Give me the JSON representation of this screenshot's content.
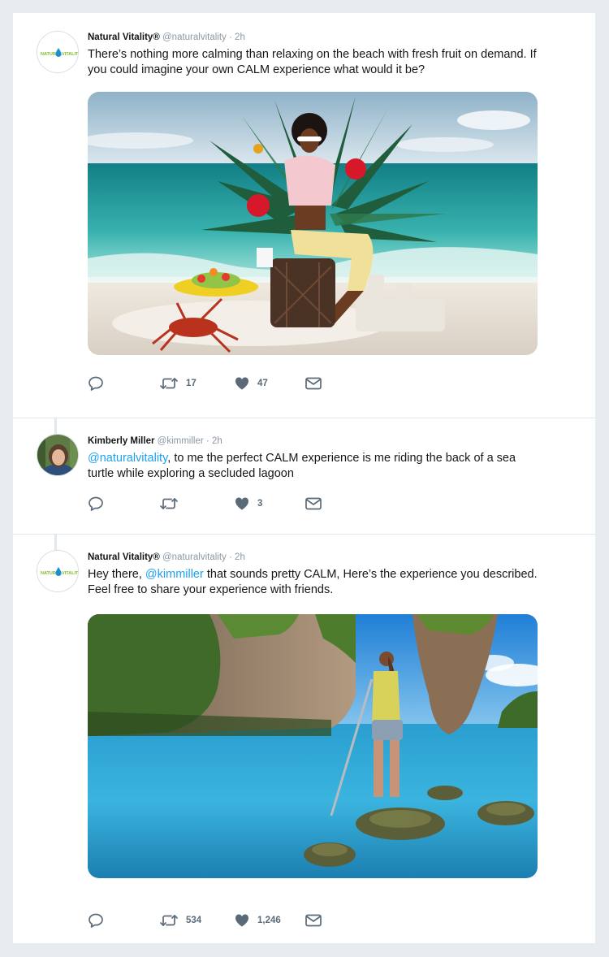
{
  "tweets": [
    {
      "name": "Natural Vitality®",
      "handle": "@naturalvitality",
      "separator": "·",
      "time": "2h",
      "text_parts": [
        {
          "text": "There’s nothing more calming than relaxing on the beach with fresh fruit on demand. If you could imagine your own CALM experience what would it be?",
          "mention": false
        }
      ],
      "avatar_text": "NATURAL VITALITY",
      "has_image": true,
      "actions": {
        "reply": "",
        "retweet": "17",
        "like": "47",
        "message": ""
      },
      "icons": [
        "reply-icon",
        "retweet-icon",
        "heart-icon",
        "envelope-icon"
      ]
    },
    {
      "name": "Kimberly Miller",
      "handle": "@kimmiller",
      "separator": "·",
      "time": "2h",
      "text_parts": [
        {
          "text": "@naturalvitality",
          "mention": true
        },
        {
          "text": ", to me the perfect CALM experience is me riding the back of a sea turtle while exploring a secluded lagoon",
          "mention": false
        }
      ],
      "has_image": false,
      "actions": {
        "reply": "",
        "retweet": "",
        "like": "3",
        "message": ""
      },
      "icons": [
        "reply-icon",
        "retweet-icon",
        "heart-icon",
        "envelope-icon"
      ]
    },
    {
      "name": "Natural Vitality®",
      "handle": "@naturalvitality",
      "separator": "·",
      "time": "2h",
      "text_parts": [
        {
          "text": "Hey there, ",
          "mention": false
        },
        {
          "text": "@kimmiller",
          "mention": true
        },
        {
          "text": " that sounds pretty CALM, Here’s the experience you described. Feel free to share your experience with friends.",
          "mention": false
        }
      ],
      "avatar_text": "NATURAL VITALITY",
      "has_image": true,
      "actions": {
        "reply": "",
        "retweet": "534",
        "like": "1,246",
        "message": ""
      },
      "icons": [
        "reply-icon",
        "retweet-icon",
        "heart-icon",
        "envelope-icon"
      ]
    }
  ],
  "colors": {
    "background": "#e6ecf0",
    "card": "#ffffff",
    "mention": "#1da1f2",
    "secondary_text": "#8b98a5",
    "icon": "#5b6a78",
    "divider": "#e1e8ed",
    "brand_green": "#7dbb2a",
    "brand_blue": "#1a8fd0"
  }
}
